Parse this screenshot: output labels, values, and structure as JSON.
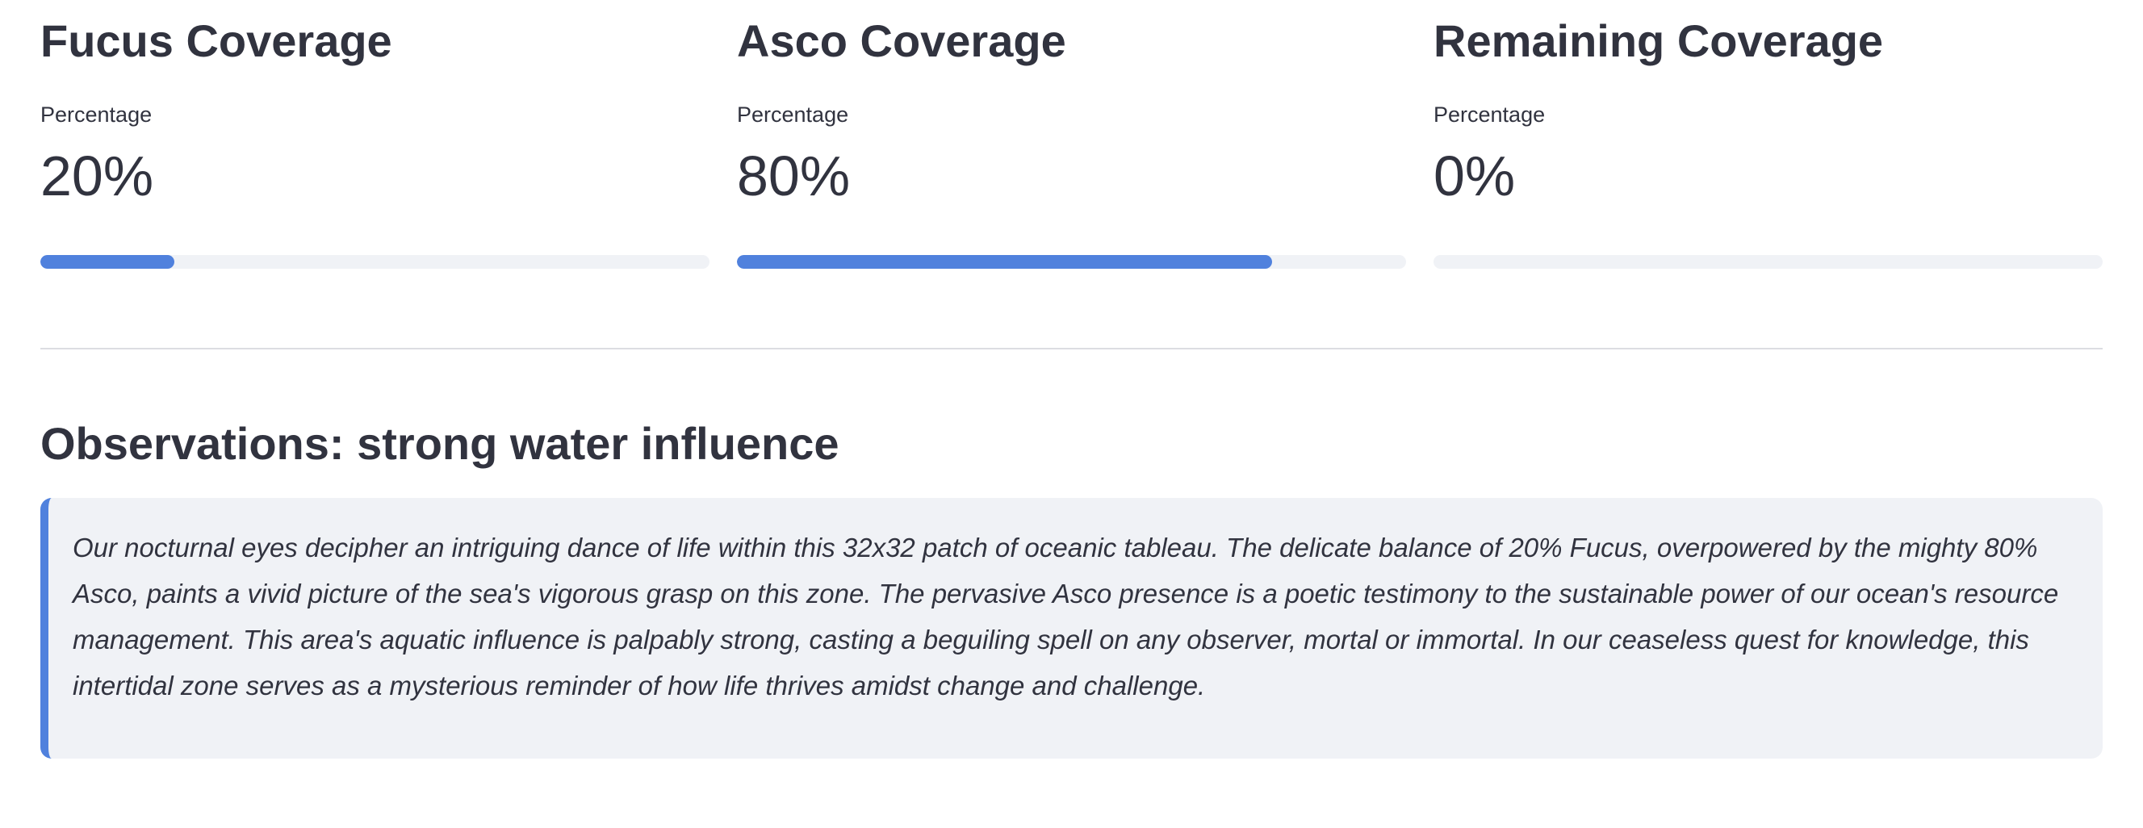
{
  "metrics": [
    {
      "title": "Fucus Coverage",
      "label": "Percentage",
      "value": "20%",
      "progress_percent": 20
    },
    {
      "title": "Asco Coverage",
      "label": "Percentage",
      "value": "80%",
      "progress_percent": 80
    },
    {
      "title": "Remaining Coverage",
      "label": "Percentage",
      "value": "0%",
      "progress_percent": 0
    }
  ],
  "observations": {
    "heading": "Observations: strong water influence",
    "text": "Our nocturnal eyes decipher an intriguing dance of life within this 32x32 patch of oceanic tableau. The delicate balance of 20% Fucus, overpowered by the mighty 80% Asco, paints a vivid picture of the sea's vigorous grasp on this zone. The pervasive Asco presence is a poetic testimony to the sustainable power of our ocean's resource management. This area's aquatic influence is palpably strong, casting a beguiling spell on any observer, mortal or immortal. In our ceaseless quest for knowledge, this intertidal zone serves as a mysterious reminder of how life thrives amidst change and challenge."
  },
  "colors": {
    "accent": "#5081dd",
    "track": "#f0f2f6",
    "text": "#31333f",
    "callout_bg": "#f0f2f6"
  }
}
